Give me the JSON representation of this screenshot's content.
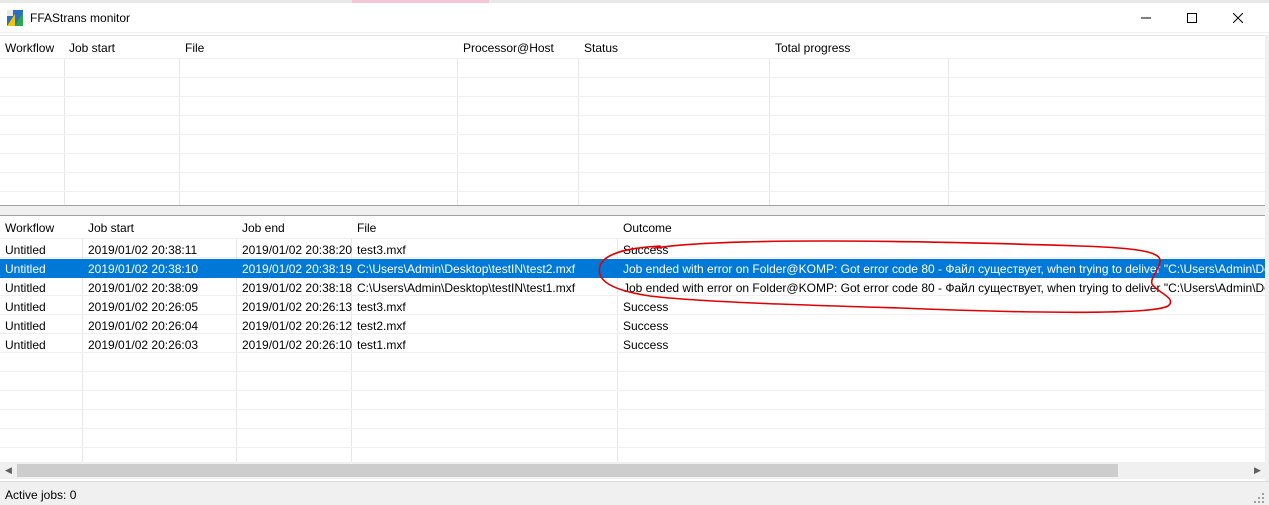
{
  "window": {
    "title": "FFAStrans monitor",
    "controls": {
      "minimize": "minimize-icon",
      "maximize": "maximize-icon",
      "close": "close-icon"
    }
  },
  "active_jobs": {
    "columns": [
      "Workflow",
      "Job start",
      "File",
      "Processor@Host",
      "Status",
      "Total progress"
    ],
    "rows": []
  },
  "history": {
    "columns": [
      "Workflow",
      "Job start",
      "Job end",
      "File",
      "Outcome"
    ],
    "rows": [
      {
        "workflow": "Untitled",
        "job_start": "2019/01/02 20:38:11",
        "job_end": "2019/01/02 20:38:20",
        "file": "test3.mxf",
        "outcome": "Success"
      },
      {
        "workflow": "Untitled",
        "job_start": "2019/01/02 20:38:10",
        "job_end": "2019/01/02 20:38:19",
        "file": "C:\\Users\\Admin\\Desktop\\testIN\\test2.mxf",
        "outcome": "Job ended with error on Folder@KOMP: Got error code 80 - Файл существует, when trying to deliver \"C:\\Users\\Admin\\De"
      },
      {
        "workflow": "Untitled",
        "job_start": "2019/01/02 20:38:09",
        "job_end": "2019/01/02 20:38:18",
        "file": "C:\\Users\\Admin\\Desktop\\testIN\\test1.mxf",
        "outcome": "Job ended with error on Folder@KOMP: Got error code 80 - Файл существует, when trying to deliver \"C:\\Users\\Admin\\De"
      },
      {
        "workflow": "Untitled",
        "job_start": "2019/01/02 20:26:05",
        "job_end": "2019/01/02 20:26:13",
        "file": "test3.mxf",
        "outcome": "Success"
      },
      {
        "workflow": "Untitled",
        "job_start": "2019/01/02 20:26:04",
        "job_end": "2019/01/02 20:26:12",
        "file": "test2.mxf",
        "outcome": "Success"
      },
      {
        "workflow": "Untitled",
        "job_start": "2019/01/02 20:26:03",
        "job_end": "2019/01/02 20:26:10",
        "file": "test1.mxf",
        "outcome": "Success"
      }
    ],
    "selected_row": 1
  },
  "status_bar": {
    "text": "Active jobs: 0"
  },
  "colors": {
    "selection": "#0078d7",
    "annotation": "#e00000"
  }
}
